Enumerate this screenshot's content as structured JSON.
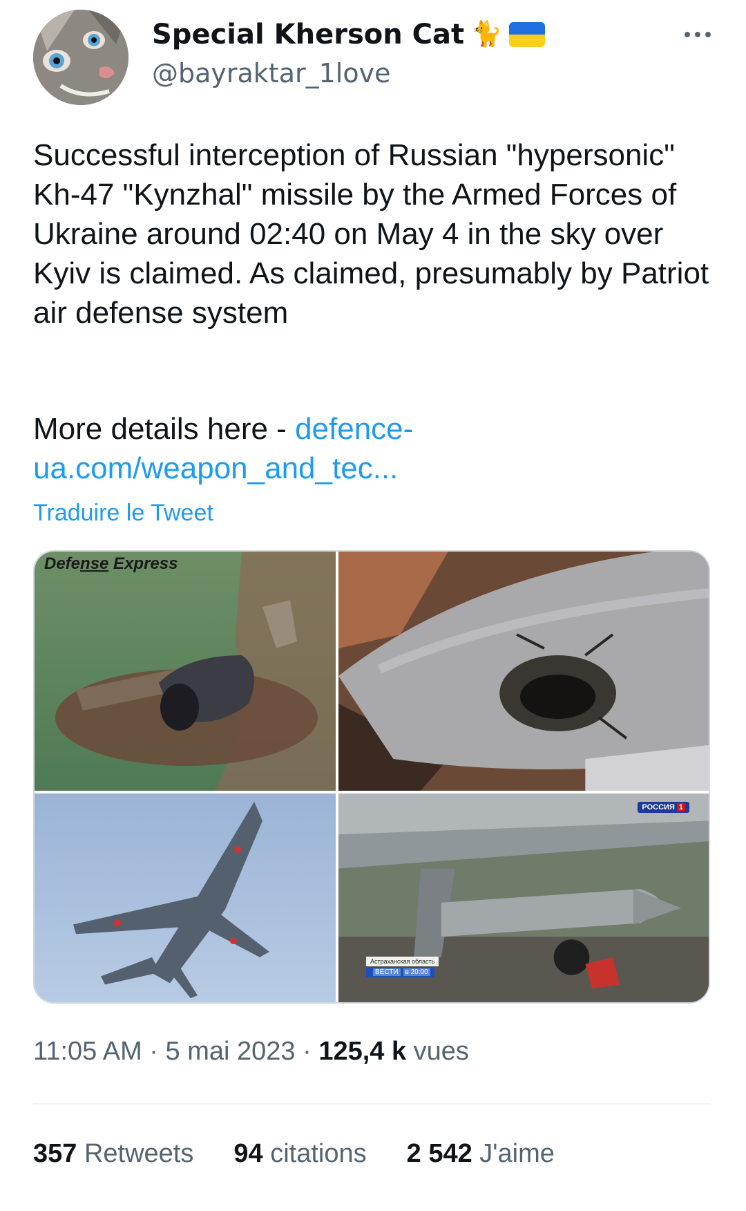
{
  "author": {
    "display_name": "Special Kherson Cat",
    "cat_emoji": "🐈",
    "handle": "@bayraktar_1love"
  },
  "tweet": {
    "text": "Successful interception of Russian \"hypersonic\" Kh-47 \"Kynzhal\" missile by the Armed Forces of Ukraine around 02:40 on May 4 in the sky over Kyiv is claimed. As claimed, presumably by Patriot air defense system",
    "details_prefix": "More details here - ",
    "link_text": "defence-ua.com/weapon_and_tec...",
    "translate_label": "Traduire le Tweet"
  },
  "media": {
    "watermark_prefix": "Defe",
    "watermark_underlined": "nse",
    "watermark_suffix": " Express",
    "tv_channel": "РОССИЯ",
    "tv_channel_number": "1",
    "tv_region": "Астраханская область",
    "tv_show": "ВЕСТИ",
    "tv_time": "в 20:00"
  },
  "meta": {
    "time": "11:05 AM",
    "separator": " · ",
    "date": "5 mai 2023",
    "views_count": "125,4 k",
    "views_label": " vues"
  },
  "stats": {
    "retweets_count": "357",
    "retweets_label": " Retweets",
    "quotes_count": "94",
    "quotes_label": " citations",
    "likes_count": "2 542",
    "likes_label": " J'aime"
  },
  "colors": {
    "link": "#1d9bf0",
    "secondary_text": "#536471",
    "primary_text": "#0f1419"
  }
}
